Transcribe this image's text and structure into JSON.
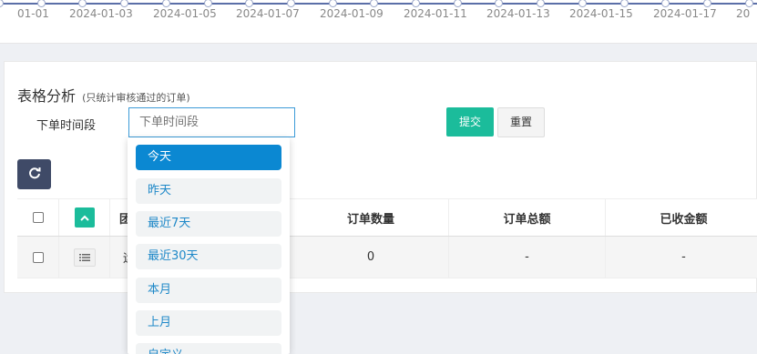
{
  "chart": {
    "x_ticks": [
      "01-01",
      "2024-01-03",
      "2024-01-05",
      "2024-01-07",
      "2024-01-09",
      "2024-01-11",
      "2024-01-13",
      "2024-01-15",
      "2024-01-17",
      "20"
    ]
  },
  "analysis": {
    "title": "表格分析",
    "subtitle": "(只统计审核通过的订单)",
    "field_label": "下单时间段",
    "time_input_placeholder": "下单时间段",
    "submit_label": "提交",
    "reset_label": "重置",
    "refresh_icon": "refresh-icon"
  },
  "table": {
    "headers": [
      "",
      "",
      "团",
      "订单数量",
      "订单总额",
      "已收金额"
    ],
    "rows": [
      [
        "",
        "",
        "运",
        "0",
        "-",
        "-"
      ]
    ]
  },
  "dropdown": {
    "items": [
      "今天",
      "昨天",
      "最近7天",
      "最近30天",
      "本月",
      "上月",
      "自定义"
    ],
    "active_index": 0
  },
  "colors": {
    "accent_green": "#1bbc9b",
    "accent_blue": "#0b88d2",
    "dark_button": "#3f4a67"
  }
}
